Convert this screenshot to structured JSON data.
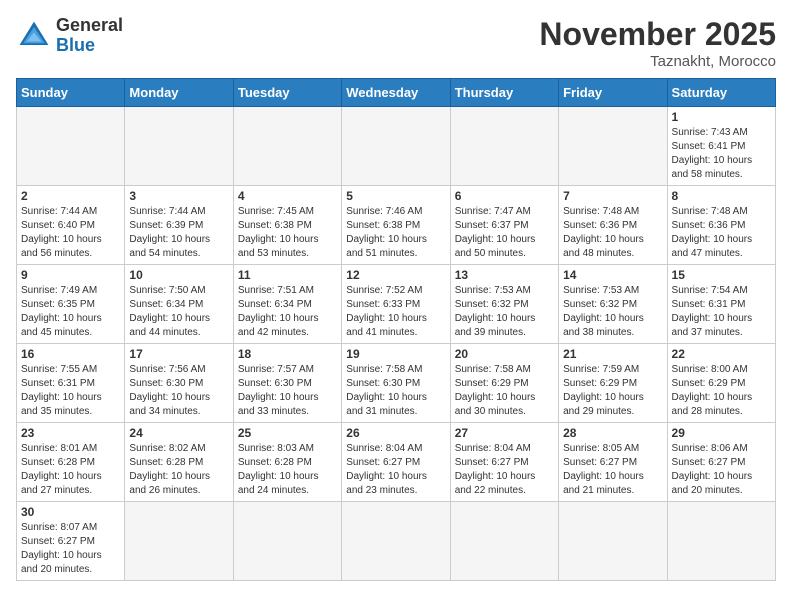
{
  "header": {
    "logo_general": "General",
    "logo_blue": "Blue",
    "month_title": "November 2025",
    "location": "Taznakht, Morocco"
  },
  "weekdays": [
    "Sunday",
    "Monday",
    "Tuesday",
    "Wednesday",
    "Thursday",
    "Friday",
    "Saturday"
  ],
  "weeks": [
    [
      {
        "day": "",
        "empty": true
      },
      {
        "day": "",
        "empty": true
      },
      {
        "day": "",
        "empty": true
      },
      {
        "day": "",
        "empty": true
      },
      {
        "day": "",
        "empty": true
      },
      {
        "day": "",
        "empty": true
      },
      {
        "day": "1",
        "sunrise": "Sunrise: 7:43 AM",
        "sunset": "Sunset: 6:41 PM",
        "daylight": "Daylight: 10 hours and 58 minutes."
      }
    ],
    [
      {
        "day": "2",
        "sunrise": "Sunrise: 7:44 AM",
        "sunset": "Sunset: 6:40 PM",
        "daylight": "Daylight: 10 hours and 56 minutes."
      },
      {
        "day": "3",
        "sunrise": "Sunrise: 7:44 AM",
        "sunset": "Sunset: 6:39 PM",
        "daylight": "Daylight: 10 hours and 54 minutes."
      },
      {
        "day": "4",
        "sunrise": "Sunrise: 7:45 AM",
        "sunset": "Sunset: 6:38 PM",
        "daylight": "Daylight: 10 hours and 53 minutes."
      },
      {
        "day": "5",
        "sunrise": "Sunrise: 7:46 AM",
        "sunset": "Sunset: 6:38 PM",
        "daylight": "Daylight: 10 hours and 51 minutes."
      },
      {
        "day": "6",
        "sunrise": "Sunrise: 7:47 AM",
        "sunset": "Sunset: 6:37 PM",
        "daylight": "Daylight: 10 hours and 50 minutes."
      },
      {
        "day": "7",
        "sunrise": "Sunrise: 7:48 AM",
        "sunset": "Sunset: 6:36 PM",
        "daylight": "Daylight: 10 hours and 48 minutes."
      },
      {
        "day": "8",
        "sunrise": "Sunrise: 7:48 AM",
        "sunset": "Sunset: 6:36 PM",
        "daylight": "Daylight: 10 hours and 47 minutes."
      }
    ],
    [
      {
        "day": "9",
        "sunrise": "Sunrise: 7:49 AM",
        "sunset": "Sunset: 6:35 PM",
        "daylight": "Daylight: 10 hours and 45 minutes."
      },
      {
        "day": "10",
        "sunrise": "Sunrise: 7:50 AM",
        "sunset": "Sunset: 6:34 PM",
        "daylight": "Daylight: 10 hours and 44 minutes."
      },
      {
        "day": "11",
        "sunrise": "Sunrise: 7:51 AM",
        "sunset": "Sunset: 6:34 PM",
        "daylight": "Daylight: 10 hours and 42 minutes."
      },
      {
        "day": "12",
        "sunrise": "Sunrise: 7:52 AM",
        "sunset": "Sunset: 6:33 PM",
        "daylight": "Daylight: 10 hours and 41 minutes."
      },
      {
        "day": "13",
        "sunrise": "Sunrise: 7:53 AM",
        "sunset": "Sunset: 6:32 PM",
        "daylight": "Daylight: 10 hours and 39 minutes."
      },
      {
        "day": "14",
        "sunrise": "Sunrise: 7:53 AM",
        "sunset": "Sunset: 6:32 PM",
        "daylight": "Daylight: 10 hours and 38 minutes."
      },
      {
        "day": "15",
        "sunrise": "Sunrise: 7:54 AM",
        "sunset": "Sunset: 6:31 PM",
        "daylight": "Daylight: 10 hours and 37 minutes."
      }
    ],
    [
      {
        "day": "16",
        "sunrise": "Sunrise: 7:55 AM",
        "sunset": "Sunset: 6:31 PM",
        "daylight": "Daylight: 10 hours and 35 minutes."
      },
      {
        "day": "17",
        "sunrise": "Sunrise: 7:56 AM",
        "sunset": "Sunset: 6:30 PM",
        "daylight": "Daylight: 10 hours and 34 minutes."
      },
      {
        "day": "18",
        "sunrise": "Sunrise: 7:57 AM",
        "sunset": "Sunset: 6:30 PM",
        "daylight": "Daylight: 10 hours and 33 minutes."
      },
      {
        "day": "19",
        "sunrise": "Sunrise: 7:58 AM",
        "sunset": "Sunset: 6:30 PM",
        "daylight": "Daylight: 10 hours and 31 minutes."
      },
      {
        "day": "20",
        "sunrise": "Sunrise: 7:58 AM",
        "sunset": "Sunset: 6:29 PM",
        "daylight": "Daylight: 10 hours and 30 minutes."
      },
      {
        "day": "21",
        "sunrise": "Sunrise: 7:59 AM",
        "sunset": "Sunset: 6:29 PM",
        "daylight": "Daylight: 10 hours and 29 minutes."
      },
      {
        "day": "22",
        "sunrise": "Sunrise: 8:00 AM",
        "sunset": "Sunset: 6:29 PM",
        "daylight": "Daylight: 10 hours and 28 minutes."
      }
    ],
    [
      {
        "day": "23",
        "sunrise": "Sunrise: 8:01 AM",
        "sunset": "Sunset: 6:28 PM",
        "daylight": "Daylight: 10 hours and 27 minutes."
      },
      {
        "day": "24",
        "sunrise": "Sunrise: 8:02 AM",
        "sunset": "Sunset: 6:28 PM",
        "daylight": "Daylight: 10 hours and 26 minutes."
      },
      {
        "day": "25",
        "sunrise": "Sunrise: 8:03 AM",
        "sunset": "Sunset: 6:28 PM",
        "daylight": "Daylight: 10 hours and 24 minutes."
      },
      {
        "day": "26",
        "sunrise": "Sunrise: 8:04 AM",
        "sunset": "Sunset: 6:27 PM",
        "daylight": "Daylight: 10 hours and 23 minutes."
      },
      {
        "day": "27",
        "sunrise": "Sunrise: 8:04 AM",
        "sunset": "Sunset: 6:27 PM",
        "daylight": "Daylight: 10 hours and 22 minutes."
      },
      {
        "day": "28",
        "sunrise": "Sunrise: 8:05 AM",
        "sunset": "Sunset: 6:27 PM",
        "daylight": "Daylight: 10 hours and 21 minutes."
      },
      {
        "day": "29",
        "sunrise": "Sunrise: 8:06 AM",
        "sunset": "Sunset: 6:27 PM",
        "daylight": "Daylight: 10 hours and 20 minutes."
      }
    ],
    [
      {
        "day": "30",
        "sunrise": "Sunrise: 8:07 AM",
        "sunset": "Sunset: 6:27 PM",
        "daylight": "Daylight: 10 hours and 20 minutes."
      },
      {
        "day": "",
        "empty": true
      },
      {
        "day": "",
        "empty": true
      },
      {
        "day": "",
        "empty": true
      },
      {
        "day": "",
        "empty": true
      },
      {
        "day": "",
        "empty": true
      },
      {
        "day": "",
        "empty": true
      }
    ]
  ]
}
